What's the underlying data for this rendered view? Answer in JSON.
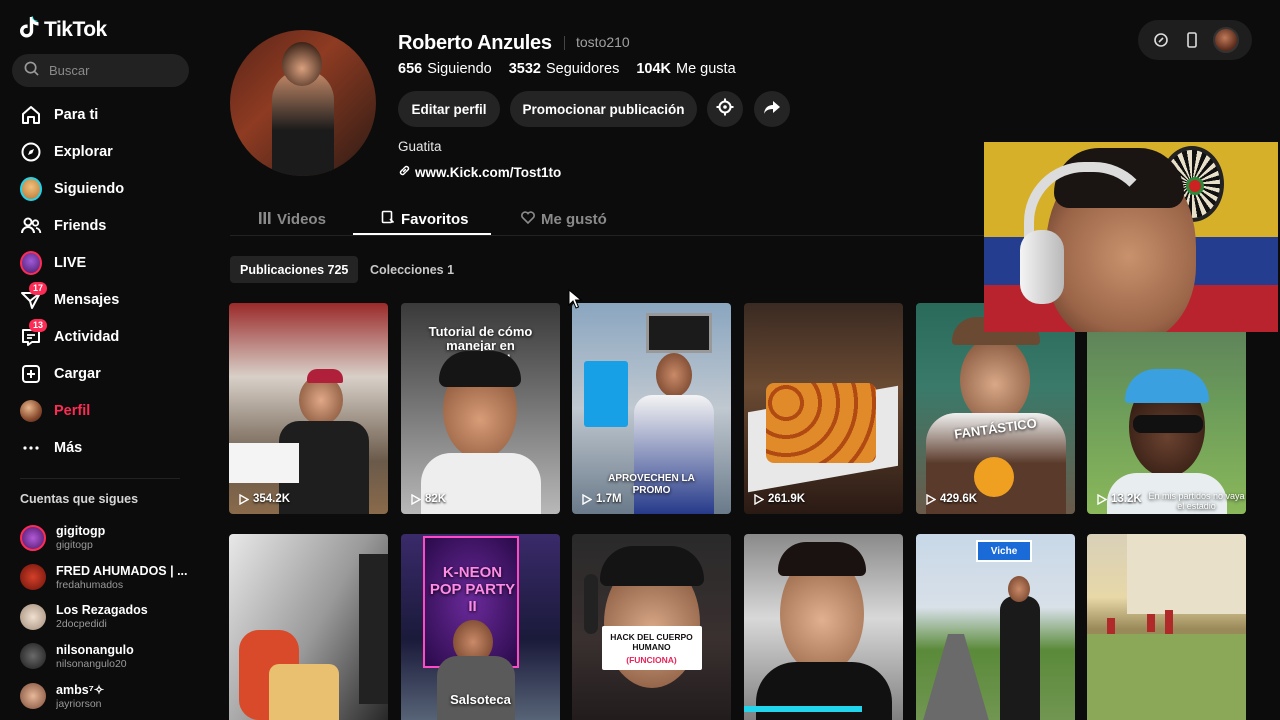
{
  "app": {
    "name": "TikTok"
  },
  "search": {
    "placeholder": "Buscar"
  },
  "nav": {
    "items": [
      {
        "label": "Para ti",
        "icon": "home-icon"
      },
      {
        "label": "Explorar",
        "icon": "compass-icon"
      },
      {
        "label": "Siguiendo",
        "icon": "following-avatar-icon"
      },
      {
        "label": "Friends",
        "icon": "friends-icon"
      },
      {
        "label": "LIVE",
        "icon": "live-avatar-icon"
      },
      {
        "label": "Mensajes",
        "icon": "messages-icon",
        "badge": "17"
      },
      {
        "label": "Actividad",
        "icon": "activity-icon",
        "badge": "13"
      },
      {
        "label": "Cargar",
        "icon": "upload-icon"
      },
      {
        "label": "Perfil",
        "icon": "profile-avatar-icon",
        "active": true
      },
      {
        "label": "Más",
        "icon": "more-icon"
      }
    ]
  },
  "following": {
    "title": "Cuentas que sigues",
    "accounts": [
      {
        "name": "gigitogp",
        "handle": "gigitogp"
      },
      {
        "name": "FRED AHUMADOS | ...",
        "handle": "fredahumados"
      },
      {
        "name": "Los Rezagados",
        "handle": "2docpedidi"
      },
      {
        "name": "nilsonangulo",
        "handle": "nilsonangulo20"
      },
      {
        "name": "ambs⁷✧",
        "handle": "jayriorson"
      }
    ]
  },
  "profile": {
    "display_name": "Roberto Anzules",
    "username": "tosto210",
    "stats": {
      "following_count": "656",
      "following_label": "Siguiendo",
      "followers_count": "3532",
      "followers_label": "Seguidores",
      "likes_count": "104K",
      "likes_label": "Me gusta"
    },
    "buttons": {
      "edit": "Editar perfil",
      "promote": "Promocionar publicación"
    },
    "bio": "Guatita",
    "link": "www.Kick.com/Tost1to"
  },
  "tabs": [
    {
      "label": "Videos"
    },
    {
      "label": "Favoritos",
      "active": true
    },
    {
      "label": "Me gustó"
    }
  ],
  "subtabs": {
    "posts": "Publicaciones 725",
    "collections": "Colecciones 1"
  },
  "videos": [
    {
      "views": "354.2K",
      "caption": ""
    },
    {
      "views": "82K",
      "caption": "Tutorial de cómo manejar en GuayaKill"
    },
    {
      "views": "1.7M",
      "caption": "APROVECHEN LA PROMO"
    },
    {
      "views": "261.9K",
      "caption": ""
    },
    {
      "views": "429.6K",
      "caption": "FANTÁSTICO"
    },
    {
      "views": "13.2K",
      "caption": "En mis partidos no vaya el estadio"
    },
    {
      "views": "",
      "caption": ""
    },
    {
      "views": "",
      "caption": "K-NEON POP PARTY II",
      "sub": "Salsoteca"
    },
    {
      "views": "",
      "caption": "HACK DEL CUERPO HUMANO",
      "sub": "(FUNCIONA)"
    },
    {
      "views": "",
      "caption": ""
    },
    {
      "views": "",
      "caption": "",
      "sign": "Viche"
    },
    {
      "views": "",
      "caption": ""
    }
  ]
}
